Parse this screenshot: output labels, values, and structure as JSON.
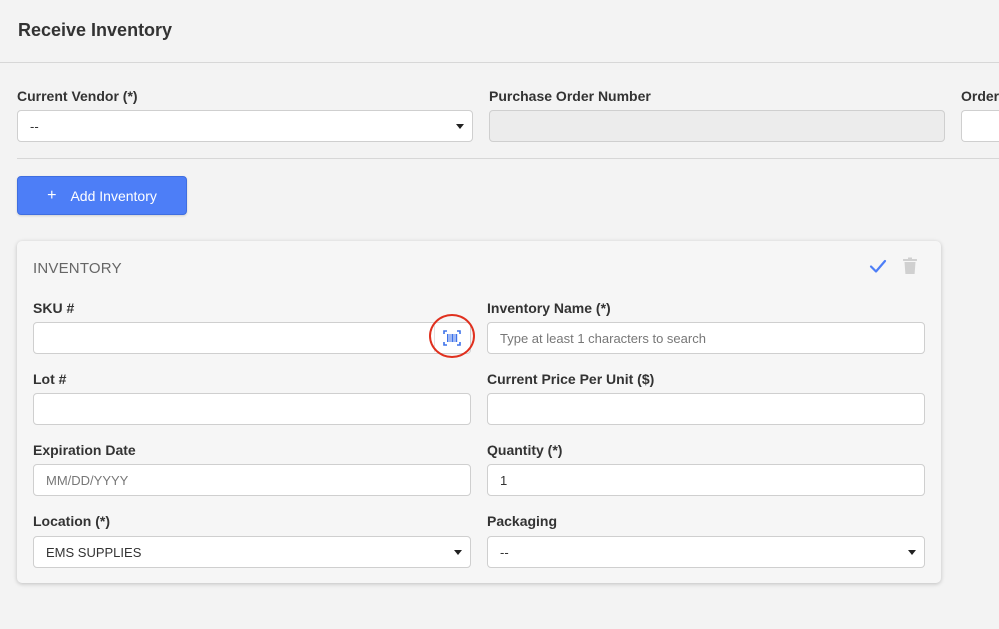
{
  "header": {
    "title": "Receive Inventory"
  },
  "form": {
    "vendor_label": "Current Vendor (*)",
    "vendor_value": "--",
    "po_label": "Purchase Order Number",
    "po_value": "",
    "order_label": "Order"
  },
  "actions": {
    "add_inventory": "Add Inventory"
  },
  "card": {
    "title": "INVENTORY",
    "sku_label": "SKU #",
    "sku_value": "",
    "inventory_name_label": "Inventory Name (*)",
    "inventory_name_placeholder": "Type at least 1 characters to search",
    "lot_label": "Lot #",
    "lot_value": "",
    "price_label": "Current Price Per Unit ($)",
    "price_value": "",
    "expiration_label": "Expiration Date",
    "expiration_placeholder": "MM/DD/YYYY",
    "quantity_label": "Quantity (*)",
    "quantity_value": "1",
    "location_label": "Location (*)",
    "location_value": "EMS SUPPLIES",
    "packaging_label": "Packaging",
    "packaging_value": "--"
  },
  "icons": {
    "plus": "plus-icon",
    "check": "check-icon",
    "trash": "trash-icon",
    "barcode": "barcode-scan-icon",
    "caret": "chevron-down-icon"
  },
  "colors": {
    "accent": "#4d7ef7",
    "highlight_ring": "#e0301e",
    "background": "#f3f3f3"
  }
}
